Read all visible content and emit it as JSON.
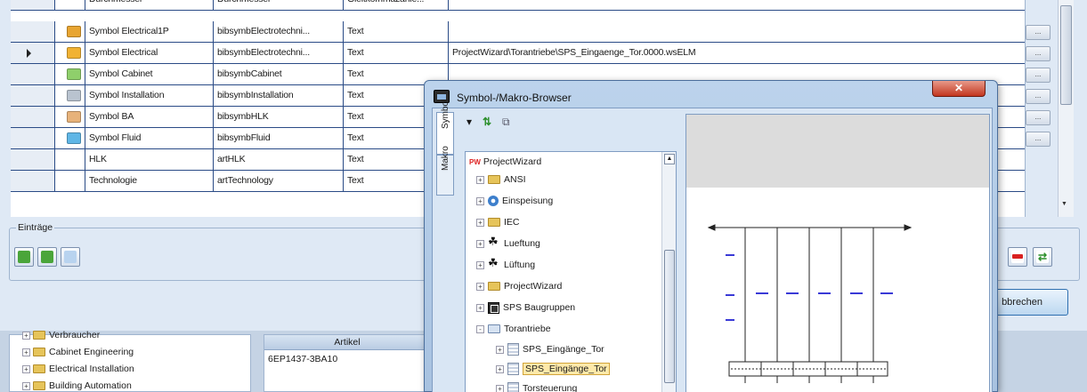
{
  "grid": {
    "rows": [
      {
        "name": "Durchmesser",
        "key": "Durchmesser",
        "type": "Gleitkommazahle...",
        "value": "",
        "icon": null,
        "current": false,
        "has_button": false
      },
      {
        "name": "Symbol Electrical1P",
        "key": "bibsymbElectrotechni...",
        "type": "Text",
        "value": "",
        "icon": "#e8a531",
        "current": false,
        "has_button": true
      },
      {
        "name": "Symbol Electrical",
        "key": "bibsymbElectrotechni...",
        "type": "Text",
        "value": "ProjectWizard\\Torantriebe\\SPS_Eingaenge_Tor.0000.wsELM",
        "icon": "#f1b233",
        "current": true,
        "has_button": true
      },
      {
        "name": "Symbol Cabinet",
        "key": "bibsymbCabinet",
        "type": "Text",
        "value": "",
        "icon": "#8fcf6b",
        "current": false,
        "has_button": true
      },
      {
        "name": "Symbol Installation",
        "key": "bibsymbInstallation",
        "type": "Text",
        "value": "",
        "icon": "#b9c3cf",
        "current": false,
        "has_button": true
      },
      {
        "name": "Symbol BA",
        "key": "bibsymbHLK",
        "type": "Text",
        "value": "",
        "icon": "#e7b27a",
        "current": false,
        "has_button": true
      },
      {
        "name": "Symbol Fluid",
        "key": "bibsymbFluid",
        "type": "Text",
        "value": "",
        "icon": "#5fb6e6",
        "current": false,
        "has_button": true
      },
      {
        "name": "HLK",
        "key": "artHLK",
        "type": "Text",
        "value": "",
        "icon": null,
        "current": false,
        "has_button": false
      },
      {
        "name": "Technologie",
        "key": "artTechnology",
        "type": "Text",
        "value": "",
        "icon": null,
        "current": false,
        "has_button": false
      }
    ]
  },
  "entries": {
    "group_label": "Einträge",
    "up_color": "#4aa53a",
    "down_color": "#4aa53a",
    "action_color": "#b8d3ef",
    "remove_color": "#d82020",
    "refresh_color": "#2c8f2c"
  },
  "cancel_label": "bbrechen",
  "lower_tree": {
    "items": [
      "Verbraucher",
      "Cabinet Engineering",
      "Electrical Installation",
      "Building Automation"
    ]
  },
  "article": {
    "header": "Artikel",
    "value": "6EP1437-3BA10"
  },
  "browser": {
    "title": "Symbol-/Makro-Browser",
    "close_label": "✕",
    "tabs": [
      "Symbol",
      "Makro"
    ],
    "tree": {
      "root": "ProjectWizard",
      "root_badge": "PW",
      "items": [
        {
          "label": "ANSI",
          "icon": "folder",
          "expand": "+"
        },
        {
          "label": "Einspeisung",
          "icon": "gear",
          "expand": "+"
        },
        {
          "label": "IEC",
          "icon": "folder",
          "expand": "+"
        },
        {
          "label": "Lueftung",
          "icon": "fan",
          "expand": "+"
        },
        {
          "label": "Lüftung",
          "icon": "fan",
          "expand": "+"
        },
        {
          "label": "ProjectWizard",
          "icon": "folder",
          "expand": "+"
        },
        {
          "label": "SPS Baugruppen",
          "icon": "sps",
          "expand": "+"
        },
        {
          "label": "Torantriebe",
          "icon": "folder-blue",
          "expand": "-"
        }
      ],
      "children": [
        {
          "label": "SPS_Eingänge_Tor",
          "selected": false
        },
        {
          "label": "SPS_Eingänge_Tor",
          "selected": true
        },
        {
          "label": "Torsteuerung",
          "selected": false
        }
      ]
    }
  }
}
